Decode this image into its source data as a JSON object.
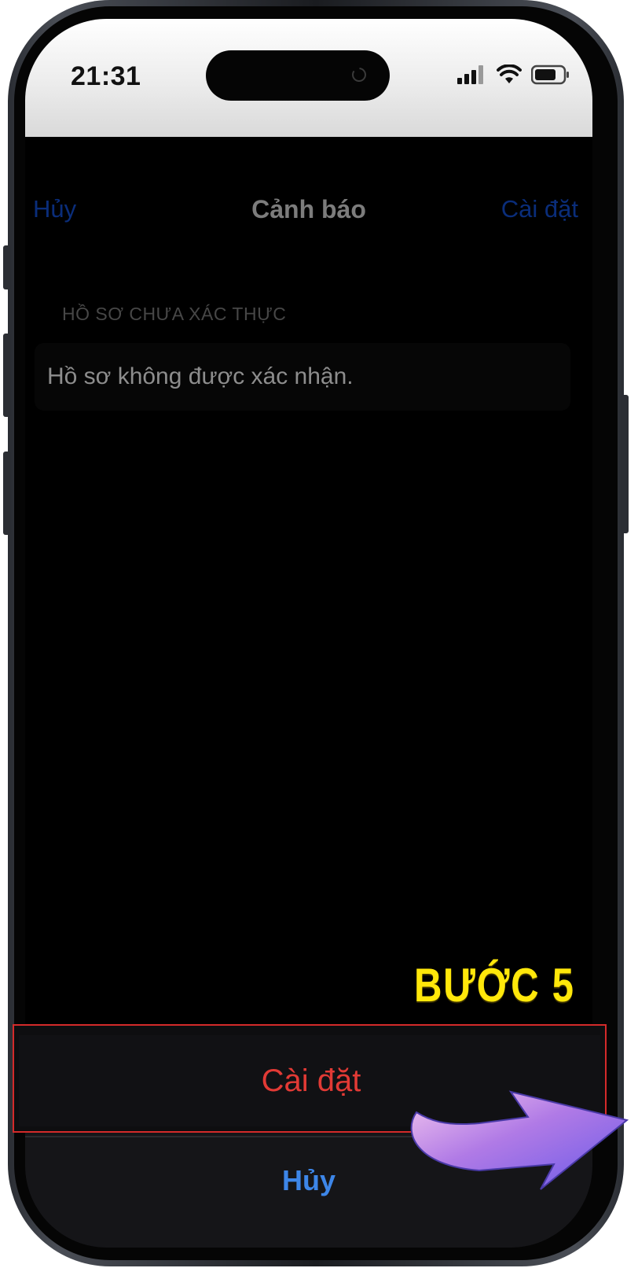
{
  "status_bar": {
    "time": "21:31",
    "icons": [
      "cellular-signal-icon",
      "wifi-icon",
      "battery-icon"
    ]
  },
  "nav": {
    "cancel_label": "Hủy",
    "title": "Cảnh báo",
    "install_label": "Cài đặt"
  },
  "content": {
    "section_header": "HỒ SƠ CHƯA XÁC THỰC",
    "message": "Hồ sơ không được xác nhận."
  },
  "action_sheet": {
    "install_label": "Cài đặt",
    "cancel_label": "Hủy"
  },
  "annotation": {
    "step_label": "BƯỚC 5",
    "arrow_icon": "curved-arrow-icon"
  },
  "colors": {
    "link_blue_dim": "#0a2d7a",
    "sheet_cancel_blue": "#3d86e8",
    "destructive_red": "#e23a35",
    "highlight_border": "#d42a2a",
    "step_yellow": "#ffe70a",
    "arrow_purple": "#8a6ff0"
  }
}
